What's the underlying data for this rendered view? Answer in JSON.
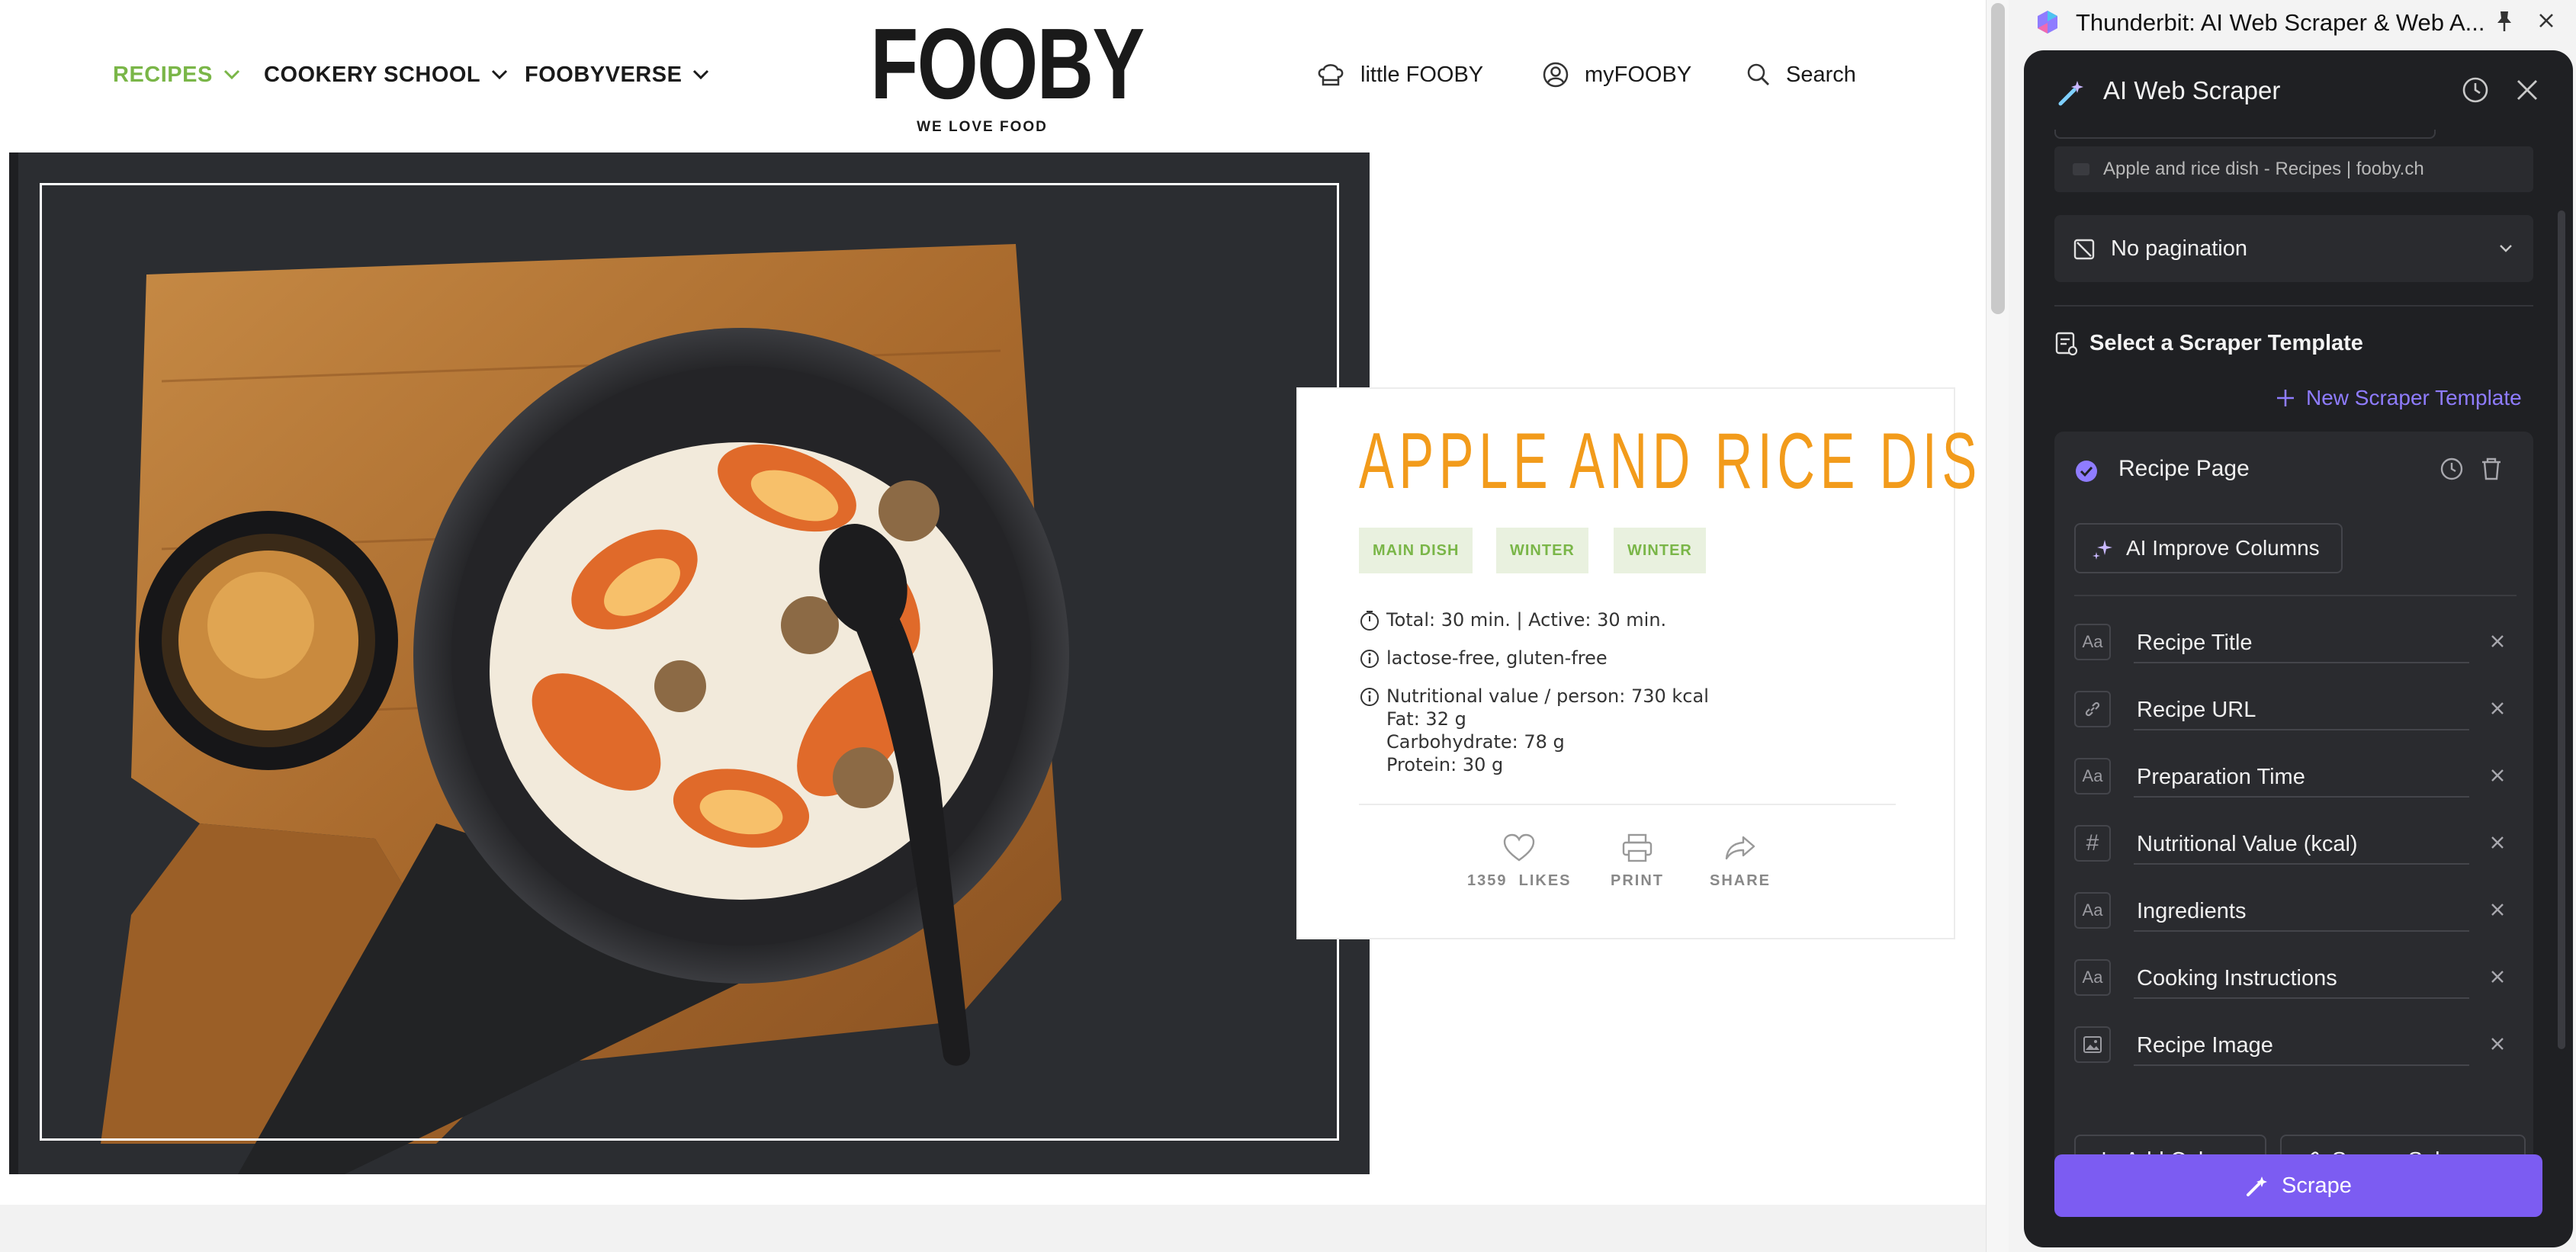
{
  "site": {
    "nav": [
      {
        "label": "RECIPES"
      },
      {
        "label": "COOKERY SCHOOL"
      },
      {
        "label": "FOOBYVERSE"
      }
    ],
    "logo": {
      "word": "FOOBY",
      "tagline": "WE LOVE FOOD"
    },
    "utility": {
      "little": "little FOOBY",
      "account": "myFOOBY",
      "search": "Search"
    },
    "recipe": {
      "title": "APPLE AND RICE DISH",
      "tags": [
        "MAIN DISH",
        "WINTER",
        "WINTER"
      ],
      "time": "Total: 30 min. | Active: 30 min.",
      "diet": "lactose-free, gluten-free",
      "nutrition": {
        "headline": "Nutritional value / person: 730 kcal",
        "fat": "Fat: 32 g",
        "carbs": "Carbohydrate: 78 g",
        "protein": "Protein: 30 g"
      },
      "actions": {
        "likes_count": "1359",
        "likes_label": "LIKES",
        "print": "PRINT",
        "share": "SHARE"
      }
    }
  },
  "extension": {
    "window_title": "Thunderbit: AI Web Scraper & Web A...",
    "panel_title": "AI Web Scraper",
    "url_text": "Apple and rice dish - Recipes | fooby.ch",
    "pagination": "No pagination",
    "template_heading": "Select a Scraper Template",
    "new_template": "New Scraper Template",
    "template": {
      "name": "Recipe Page",
      "improve": "AI Improve Columns",
      "columns": [
        {
          "type": "text-type",
          "name": "Recipe Title"
        },
        {
          "type": "url-type",
          "name": "Recipe URL"
        },
        {
          "type": "text-type",
          "name": "Preparation Time"
        },
        {
          "type": "number-type",
          "name": "Nutritional Value (kcal)"
        },
        {
          "type": "text-type",
          "name": "Ingredients"
        },
        {
          "type": "text-type",
          "name": "Cooking Instructions"
        },
        {
          "type": "image-type",
          "name": "Recipe Image"
        }
      ],
      "add_column": "Add Column",
      "scrape_subpages": "Scrape Subpages"
    },
    "scrape": "Scrape",
    "colors": {
      "accent": "#7c5cf2",
      "link": "#8f7cff",
      "panel_bg": "#1f2023",
      "brand_green": "#7ab648",
      "title_orange": "#f29b1b"
    }
  }
}
